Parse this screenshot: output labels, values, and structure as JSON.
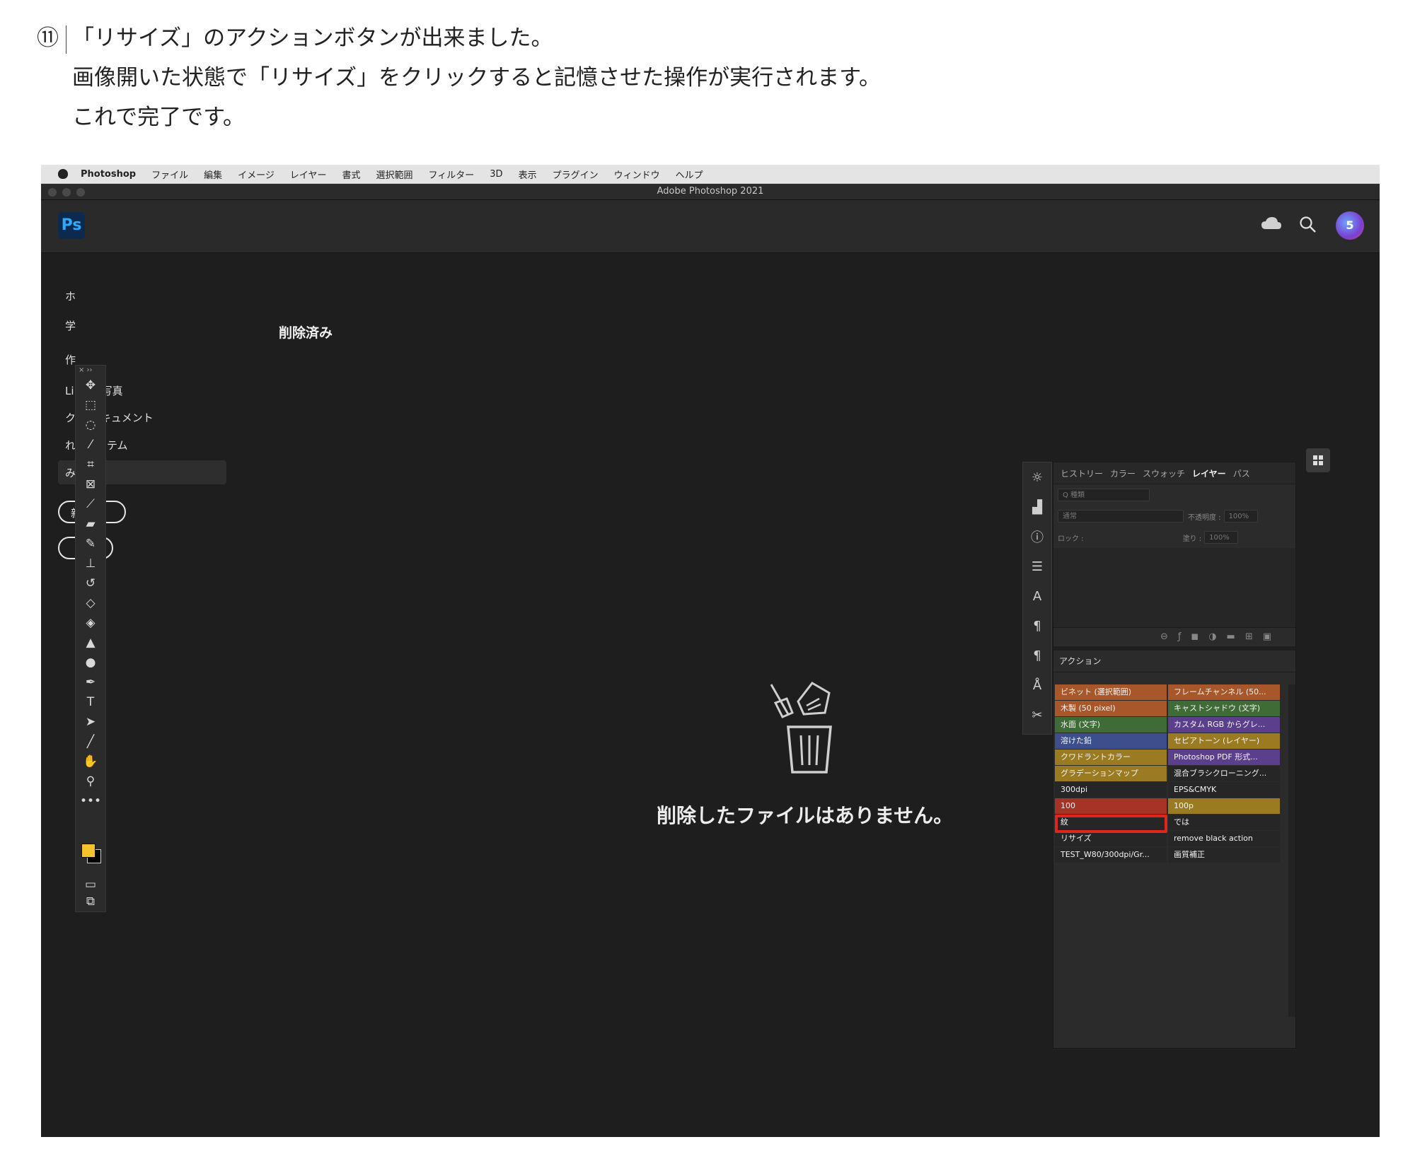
{
  "instructions": {
    "step_number": "⑪",
    "lines": [
      "「リサイズ」のアクションボタンが出来ました。",
      "画像開いた状態で「リサイズ」をクリックすると記憶させた操作が実行されます。",
      "これで完了です。"
    ]
  },
  "menubar": {
    "items": [
      "Photoshop",
      "ファイル",
      "編集",
      "イメージ",
      "レイヤー",
      "書式",
      "選択範囲",
      "フィルター",
      "3D",
      "表示",
      "プラグイン",
      "ウィンドウ",
      "ヘルプ"
    ]
  },
  "window": {
    "title": "Adobe Photoshop 2021"
  },
  "header": {
    "logo": "Ps",
    "avatar_glyph": "5",
    "icons": [
      "cloud-icon",
      "search-icon"
    ]
  },
  "home": {
    "sidebar": {
      "items": [
        {
          "label": "ホ"
        },
        {
          "label": "学"
        },
        {
          "label": "作"
        },
        {
          "label": "Li        m の写真"
        },
        {
          "label": "ク      ドドキュメント"
        },
        {
          "label": "        れたアイテム"
        },
        {
          "label": "        み"
        }
      ],
      "pill1": "新      成",
      "pill2": ""
    },
    "section_title": "削除済み",
    "empty_message": "削除したファイルはありません。"
  },
  "panel": {
    "tabs": [
      "ヒストリー",
      "カラー",
      "スウォッチ",
      "レイヤー",
      "パス"
    ],
    "active_tab": "レイヤー",
    "search_placeholder": "Q 種類",
    "blend_mode": "通常",
    "opacity_label": "不透明度 :",
    "opacity_value": "100%",
    "lock_label": "ロック :",
    "fill_label": "塗り :",
    "fill_value": "100%",
    "actions_title": "アクション",
    "actions": [
      [
        {
          "label": "ビネット (選択範囲)",
          "color": "orange"
        },
        {
          "label": "フレームチャンネル (50...",
          "color": "orange"
        }
      ],
      [
        {
          "label": "木製 (50 pixel)",
          "color": "orange"
        },
        {
          "label": "キャストシャドウ (文字)",
          "color": "green"
        }
      ],
      [
        {
          "label": "水面 (文字)",
          "color": "green"
        },
        {
          "label": "カスタム RGB からグレ...",
          "color": "violet"
        }
      ],
      [
        {
          "label": "溶けた鉛",
          "color": "blue"
        },
        {
          "label": "セピアトーン (レイヤー)",
          "color": "yellow"
        }
      ],
      [
        {
          "label": "クワドラントカラー",
          "color": "yellow"
        },
        {
          "label": "Photoshop PDF 形式...",
          "color": "violet"
        }
      ],
      [
        {
          "label": "グラデーションマップ",
          "color": "yellow"
        },
        {
          "label": "混合ブラシクローニング...",
          "color": "gray"
        }
      ],
      [
        {
          "label": "300dpi",
          "color": "gray"
        },
        {
          "label": "EPS&CMYK",
          "color": "gray"
        }
      ],
      [
        {
          "label": "100",
          "color": "red"
        },
        {
          "label": "100p",
          "color": "yellow"
        }
      ],
      [
        {
          "label": "紋",
          "color": "gray"
        },
        {
          "label": "では",
          "color": "gray"
        }
      ],
      [
        {
          "label": "リサイズ",
          "color": "gray"
        },
        {
          "label": "remove black action",
          "color": "gray"
        }
      ],
      [
        {
          "label": "TEST_W80/300dpi/Gr...",
          "color": "gray"
        },
        {
          "label": "画質補正",
          "color": "gray"
        }
      ]
    ],
    "highlighted_action": "リサイズ",
    "highlight_color": "#e0261c"
  },
  "toolbar": {
    "tools": [
      "move-tool-icon",
      "marquee-icon",
      "lasso-icon",
      "magic-wand-icon",
      "crop-icon",
      "frame-icon",
      "eyedropper-icon",
      "healing-icon",
      "brush-icon",
      "stamp-icon",
      "history-brush-icon",
      "eraser-icon",
      "paint-bucket-icon",
      "blur-icon",
      "dodge-icon",
      "pen-icon",
      "type-icon",
      "path-select-icon",
      "line-icon",
      "hand-icon",
      "zoom-icon",
      "more-icon"
    ],
    "foreground_color": "#f5c32c",
    "background_color": "#000000"
  }
}
